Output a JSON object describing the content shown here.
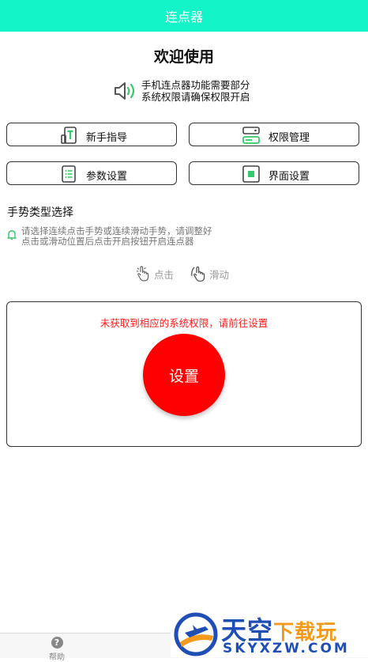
{
  "app": {
    "title": "连点器",
    "accent": "#13f5c8"
  },
  "welcome": "欢迎使用",
  "notice": {
    "line1": "手机连点器功能需要部分",
    "line2": "系统权限请确保权限开启",
    "icon": "speaker-icon"
  },
  "buttons": [
    {
      "label": "新手指导",
      "icon": "tutorial-icon"
    },
    {
      "label": "权限管理",
      "icon": "permission-icon"
    },
    {
      "label": "参数设置",
      "icon": "list-icon"
    },
    {
      "label": "界面设置",
      "icon": "square-icon"
    }
  ],
  "gesture": {
    "title": "手势类型选择",
    "hint_line1": "请选择连续点击手势或连续滑动手势，请调整好",
    "hint_line2": "点击或滑动位置后点击开启按钮开启连点器",
    "options": [
      {
        "label": "点击"
      },
      {
        "label": "滑动"
      }
    ]
  },
  "panel": {
    "warning": "未获取到相应的系统权限，请前往设置",
    "button_label": "设置",
    "warning_color": "#ff1a1a",
    "button_color": "#ff0000"
  },
  "bottom": {
    "help_label": "帮助"
  },
  "watermark": {
    "main": "天空",
    "accent": "下载玩",
    "url": "SKYXZW.COM"
  }
}
